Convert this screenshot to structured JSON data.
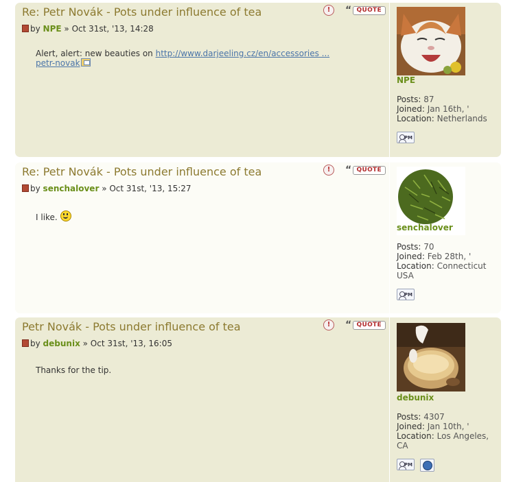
{
  "posts": [
    {
      "title": "Re: Petr Novák - Pots under influence of tea",
      "by": "by",
      "author": "NPE",
      "date": "» Oct 31st, '13, 14:28",
      "content_text": "Alert, alert: new beauties on ",
      "content_link": "http://www.darjeeling.cz/en/accessories ...",
      "content_link2": "petr-novak",
      "username": "NPE",
      "posts_label": "Posts:",
      "posts_value": "87",
      "joined_label": "Joined:",
      "joined_value": "Jan 16th, '",
      "location_label": "Location:",
      "location_value": "Netherlands",
      "location_value2": ""
    },
    {
      "title": "Re: Petr Novák - Pots under influence of tea",
      "by": "by",
      "author": "senchalover",
      "date": "» Oct 31st, '13, 15:27",
      "content_text": "I like.",
      "username": "senchalover",
      "posts_label": "Posts:",
      "posts_value": "70",
      "joined_label": "Joined:",
      "joined_value": "Feb 28th, '",
      "location_label": "Location:",
      "location_value": "Connecticut",
      "location_value2": "USA"
    },
    {
      "title": "Petr Novák - Pots under influence of tea",
      "by": "by",
      "author": "debunix",
      "date": "» Oct 31st, '13, 16:05",
      "content_text": "Thanks for the tip.",
      "username": "debunix",
      "posts_label": "Posts:",
      "posts_value": "4307",
      "joined_label": "Joined:",
      "joined_value": "Jan 10th, '",
      "location_label": "Location:",
      "location_value": "Los Angeles,",
      "location_value2": "CA"
    }
  ],
  "buttons": {
    "report": "!",
    "quote_mark": "“",
    "quote": "QUOTE",
    "pm": "PM"
  },
  "colors": {
    "post_bg_alt1": "#ecebd5",
    "post_bg_alt2": "#fcfcf6",
    "title": "#8c7a30",
    "author": "#6a8f1a",
    "link": "#4a74a8"
  }
}
